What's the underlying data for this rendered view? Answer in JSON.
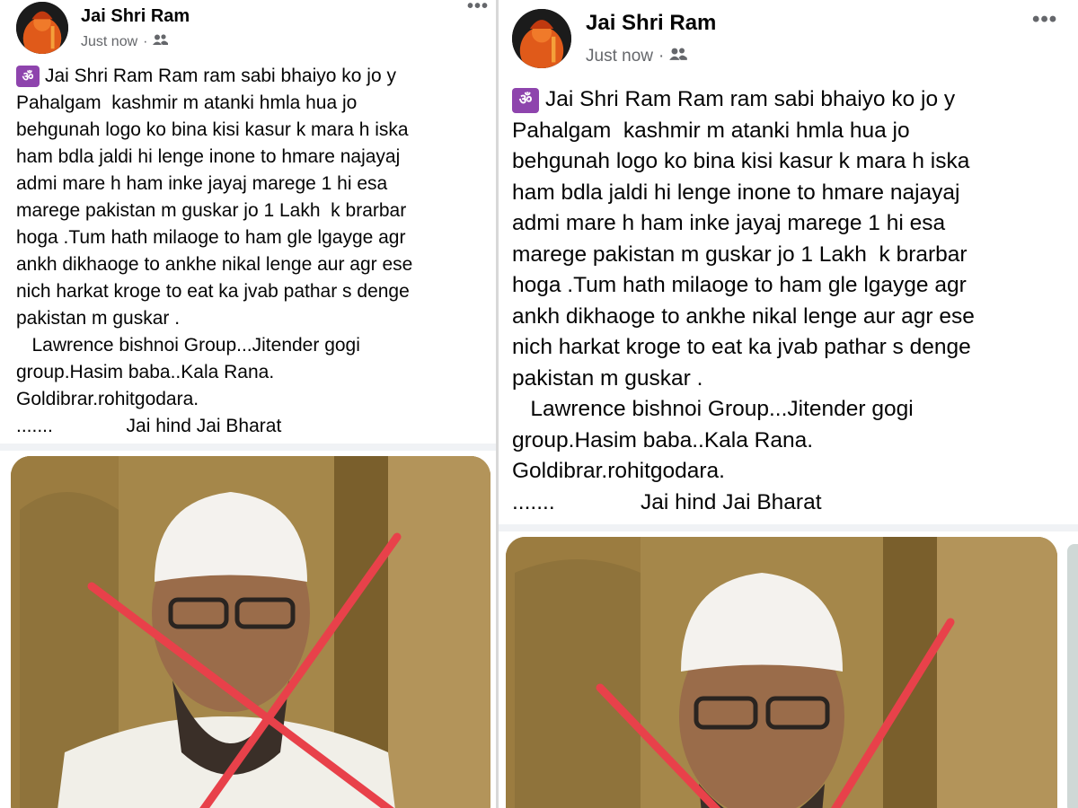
{
  "post": {
    "author": "Jai Shri Ram",
    "timestamp": "Just now",
    "separator": "·",
    "audience_icon": "friends-icon",
    "more_label": "•••",
    "om_symbol": "ॐ",
    "body_lines": [
      "Jai Shri Ram Ram ram sabi bhaiyo ko jo y",
      "Pahalgam  kashmir m atanki hmla hua jo",
      "behgunah logo ko bina kisi kasur k mara h iska",
      "ham bdla jaldi hi lenge inone to hmare najayaj",
      "admi mare h ham inke jayaj marege 1 hi esa",
      "marege pakistan m guskar jo 1 Lakh  k brarbar",
      "hoga .Tum hath milaoge to ham gle lgayge agr",
      "ankh dikhaoge to ankhe nikal lenge aur agr ese",
      "nich harkat kroge to eat ka jvab pathar s denge",
      "pakistan m guskar .",
      "   Lawrence bishnoi Group...Jitender gogi",
      "group.Hasim baba..Kala Rana.",
      "Goldibrar.rohitgodara.",
      ".......              Jai hind Jai Bharat"
    ]
  },
  "colors": {
    "om_badge": "#8e44ad",
    "meta_text": "#65676b",
    "cross": "#e8414a"
  }
}
